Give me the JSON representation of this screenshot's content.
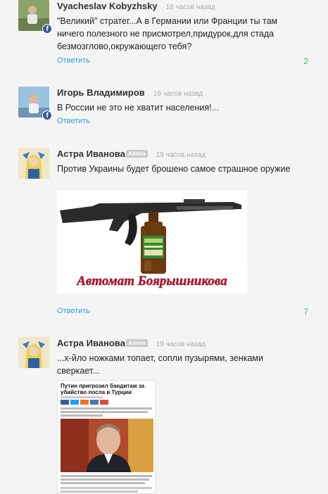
{
  "comments": [
    {
      "author": "Vyacheslav Kobyzhsky",
      "time": "18 часов назад",
      "text": "\"Великий\" стратег...А в Германии или Франции ты там ничего полезного не присмотрел,придурок,для стада безмозглово,окружающего тебя?",
      "reply": "Ответить",
      "count": "2"
    },
    {
      "author": "Игорь Владимиров",
      "time": "19 часов назад",
      "text": "В России не это не хватит населения!...",
      "reply": "Ответить"
    },
    {
      "author": "Астра Иванова",
      "badge": "Admin",
      "time": "19 часов назад",
      "text": "Против Украины  будет брошено самое  страшное оружие",
      "image_caption": "Автомат Боярышникова",
      "reply": "Ответить",
      "count": "7"
    },
    {
      "author": "Астра Иванова",
      "badge": "Admin",
      "time": "19 часов назад",
      "text": "...х-йло ножками топает, сопли пузырями,   зенками сверкает...",
      "article_title": "Путин пригрозил бандитам за убийство посла в Турции"
    }
  ],
  "colors": {
    "link": "#2a9fd6",
    "count": "#3cb371",
    "facebook": "#3b5998",
    "caption_red": "#c8102e"
  }
}
